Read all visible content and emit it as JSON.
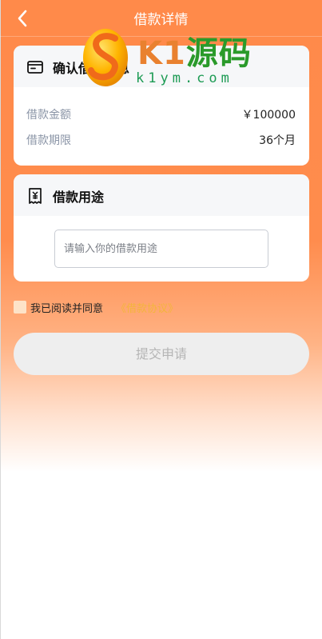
{
  "header": {
    "title": "借款详情"
  },
  "confirm_card": {
    "title": "确认借款信息",
    "rows": [
      {
        "key": "借款金额",
        "value": "￥100000"
      },
      {
        "key": "借款期限",
        "value": "36个月"
      }
    ]
  },
  "purpose_card": {
    "title": "借款用途",
    "input_placeholder": "请输入你的借款用途",
    "input_value": ""
  },
  "agreement": {
    "text": "我已阅读并同意",
    "link": "《借款协议》"
  },
  "submit": {
    "label": "提交申请"
  },
  "watermark": {
    "main": "K1源码",
    "sub": "k1ym.com"
  },
  "colors": {
    "header_orange": "#ff8a4a",
    "link": "#f3b53c",
    "button_bg": "#eeeeee",
    "button_text": "#b5b5b5"
  }
}
